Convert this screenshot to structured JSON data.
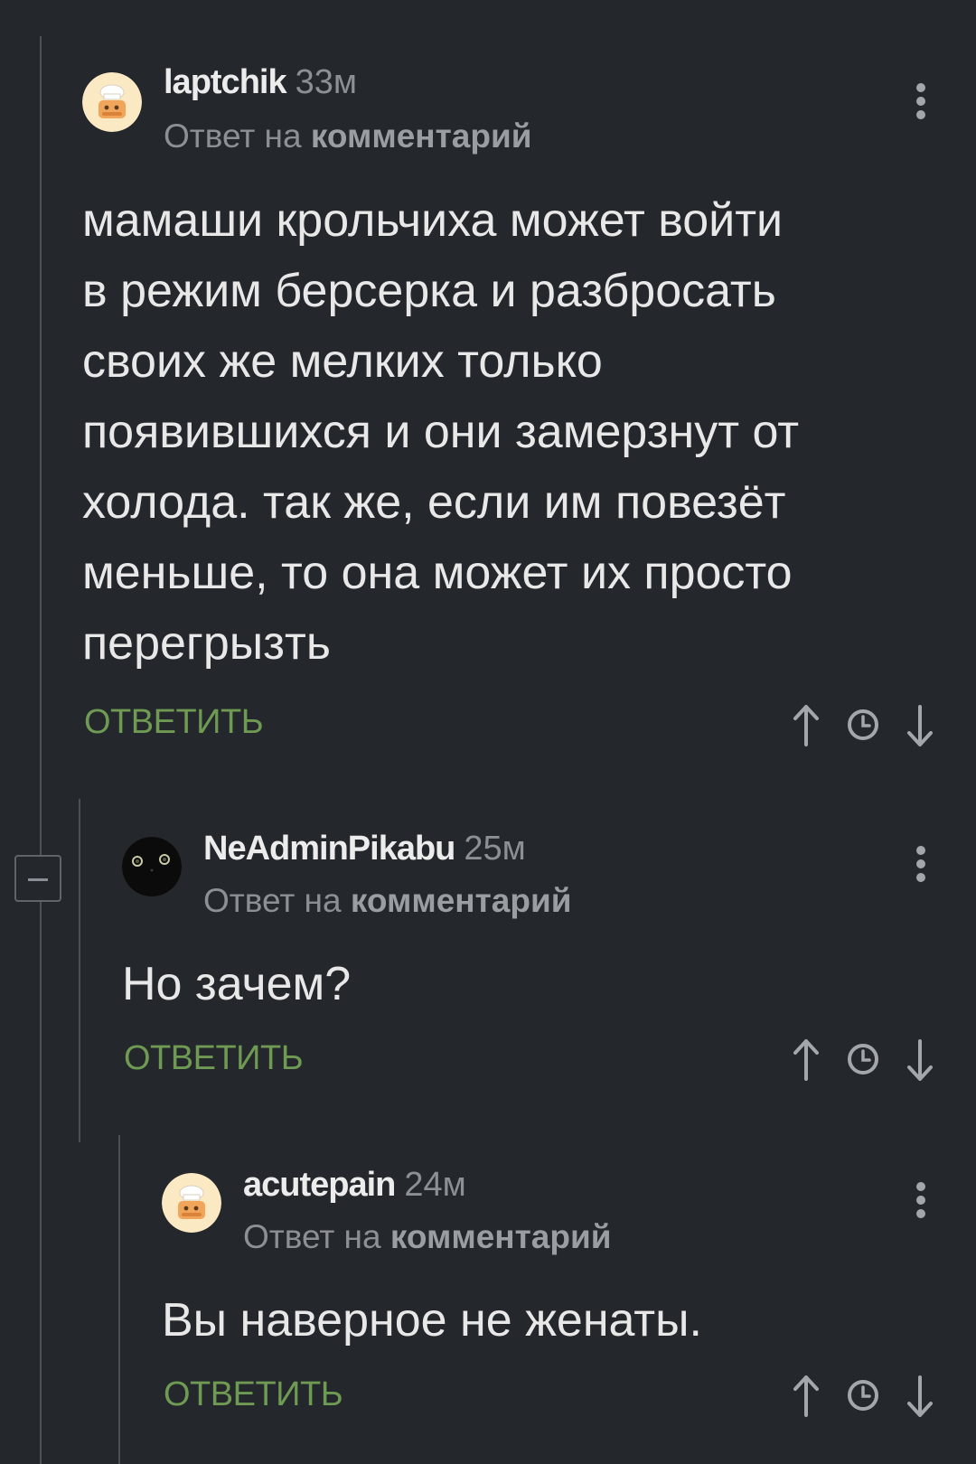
{
  "comments": [
    {
      "username": "laptchik",
      "time": "33м",
      "reply_prefix": "Ответ на",
      "reply_link": "комментарий",
      "text": "мамаши крольчиха может войти\nв режим берсерка и разбросать\nсвоих же мелких только\nпоявившихся и они замерзнут от\nхолода. так же, если им повезёт\nменьше, то она может их просто\nперегрызть",
      "reply_label": "ОТВЕТИТЬ",
      "avatar_icon": "chef-avatar-icon"
    },
    {
      "username": "NeAdminPikabu",
      "time": "25м",
      "reply_prefix": "Ответ на",
      "reply_link": "комментарий",
      "text": "Но зачем?",
      "reply_label": "ОТВЕТИТЬ",
      "avatar_icon": "black-cat-avatar-icon"
    },
    {
      "username": "acutepain",
      "time": "24м",
      "reply_prefix": "Ответ на",
      "reply_link": "комментарий",
      "text": "Вы наверное не женаты.",
      "reply_label": "ОТВЕТИТЬ",
      "avatar_icon": "chef-avatar-icon"
    }
  ],
  "icons": {
    "more": "kebab-menu-icon",
    "collapse": "collapse-minus-icon",
    "upvote": "arrow-up-icon",
    "time": "clock-icon",
    "downvote": "arrow-down-icon"
  },
  "colors": {
    "background": "#24272b",
    "reply_button": "#6f9a53",
    "meta_text": "#8c8f93",
    "thread_line": "#4c5055"
  }
}
